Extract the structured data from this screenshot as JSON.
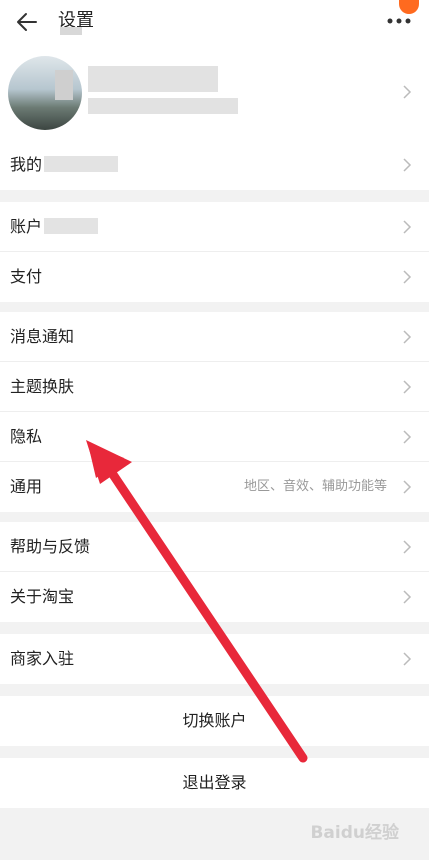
{
  "header": {
    "title": "设置",
    "back_icon": "back-arrow-icon",
    "more_icon": "more-dots-icon"
  },
  "sections": {
    "account": [
      {
        "label": "我的"
      },
      {
        "label": "账户"
      },
      {
        "label": "支付"
      }
    ],
    "settings": [
      {
        "label": "消息通知",
        "value": ""
      },
      {
        "label": "主题换肤",
        "value": ""
      },
      {
        "label": "隐私",
        "value": ""
      },
      {
        "label": "通用",
        "value": "地区、音效、辅助功能等"
      }
    ],
    "help": [
      {
        "label": "帮助与反馈"
      },
      {
        "label": "关于淘宝"
      }
    ],
    "merchant": [
      {
        "label": "商家入驻"
      }
    ]
  },
  "actions": {
    "switch_account": "切换账户",
    "logout": "退出登录"
  },
  "watermark": "Baidu经验",
  "colors": {
    "accent": "#ff6a1f",
    "arrow": "#e8283a"
  }
}
